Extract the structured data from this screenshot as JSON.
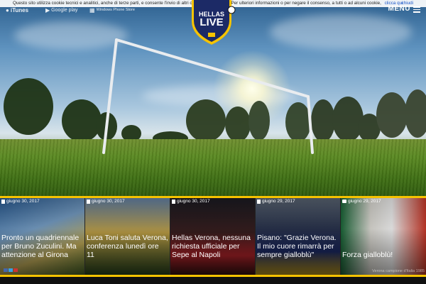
{
  "cookie": {
    "text": "Questo sito utilizza cookie tecnici e analitici, anche di terze parti, e consente l'invio di altri cookie di terze parti. Per ulteriori informazioni o per negare il consenso, a tutti o ad alcuni cookie,",
    "accept_label": "clicca qui",
    "close_label": "chiudi"
  },
  "stores": {
    "itunes": "iTunes",
    "google_play": "Google play",
    "windows_phone": "Windows Phone Store"
  },
  "menu_label": "MENU",
  "logo": {
    "top": "HELLAS",
    "main": "LIVE"
  },
  "news": [
    {
      "date": "giugno 30, 2017",
      "type": "article",
      "title": "Pronto un quadriennale per Bruno Zuculini. Ma attenzione al Girona"
    },
    {
      "date": "giugno 30, 2017",
      "type": "article",
      "title": "Luca Toni saluta Verona, conferenza lunedì ore 11"
    },
    {
      "date": "giugno 30, 2017",
      "type": "article",
      "title": "Hellas Verona, nessuna richiesta ufficiale per Sepe al Napoli"
    },
    {
      "date": "giugno 29, 2017",
      "type": "article",
      "title": "Pisano: \"Grazie Verona. Il mio cuore rimarrà per sempre gialloblù\""
    },
    {
      "date": "giugno 29, 2017",
      "type": "video",
      "title": "Forza gialloblù!",
      "watermark": "Verona campione d'Italia 1985"
    }
  ],
  "colors": {
    "accent": "#f6c300",
    "link": "#1a55c8"
  }
}
